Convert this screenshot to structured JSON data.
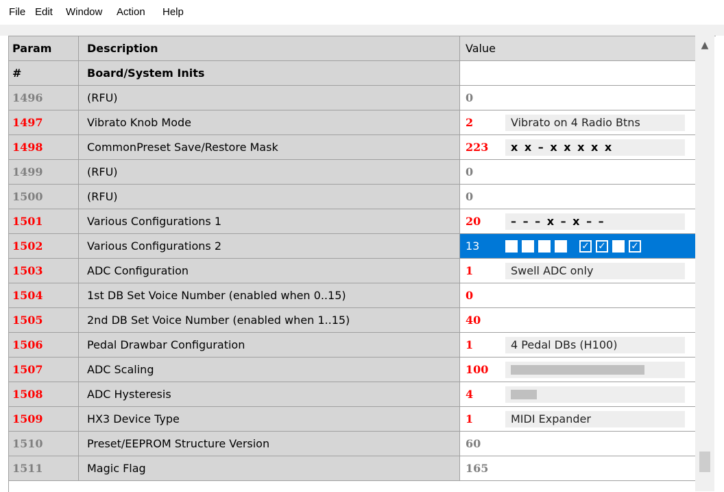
{
  "menu": [
    "File",
    "Edit",
    "Window",
    "Action",
    "Help"
  ],
  "columns": {
    "param": "Param",
    "description": "Description",
    "value": "Value"
  },
  "section": {
    "param": "#",
    "description": "Board/System Inits"
  },
  "colors": {
    "active_param": "#ff0000",
    "inactive_param": "#808080",
    "selection": "#0078d7"
  },
  "rows": [
    {
      "param": "1496",
      "description": "(RFU)",
      "value": "0",
      "active": false
    },
    {
      "param": "1497",
      "description": "Vibrato Knob Mode",
      "value": "2",
      "active": true,
      "extra": "Vibrato on 4 Radio Btns"
    },
    {
      "param": "1498",
      "description": "CommonPreset Save/Restore Mask",
      "value": "223",
      "active": true,
      "extra": "x x – x  x x x x"
    },
    {
      "param": "1499",
      "description": "(RFU)",
      "value": "0",
      "active": false
    },
    {
      "param": "1500",
      "description": "(RFU)",
      "value": "0",
      "active": false
    },
    {
      "param": "1501",
      "description": "Various Configurations 1",
      "value": "20",
      "active": true,
      "extra": "– – – x  – x – –"
    },
    {
      "param": "1502",
      "description": "Various Configurations 2",
      "value": "13",
      "active": true,
      "selected": true,
      "bits": [
        false,
        false,
        false,
        false,
        true,
        true,
        false,
        true
      ]
    },
    {
      "param": "1503",
      "description": "ADC Configuration",
      "value": "1",
      "active": true,
      "extra": "Swell ADC only"
    },
    {
      "param": "1504",
      "description": "1st DB Set Voice Number (enabled when 0..15)",
      "value": "0",
      "active": true
    },
    {
      "param": "1505",
      "description": "2nd DB Set Voice Number (enabled when 1..15)",
      "value": "40",
      "active": true
    },
    {
      "param": "1506",
      "description": "Pedal Drawbar Configuration",
      "value": "1",
      "active": true,
      "extra": "4 Pedal DBs (H100)"
    },
    {
      "param": "1507",
      "description": "ADC Scaling",
      "value": "100",
      "active": true,
      "bar_fraction": 0.39
    },
    {
      "param": "1508",
      "description": "ADC Hysteresis",
      "value": "4",
      "active": true,
      "bar_fraction": 0.016
    },
    {
      "param": "1509",
      "description": "HX3 Device Type",
      "value": "1",
      "active": true,
      "extra": "MIDI Expander"
    },
    {
      "param": "1510",
      "description": "Preset/EEPROM Structure Version",
      "value": "60",
      "active": false
    },
    {
      "param": "1511",
      "description": "Magic Flag",
      "value": "165",
      "active": false
    }
  ]
}
